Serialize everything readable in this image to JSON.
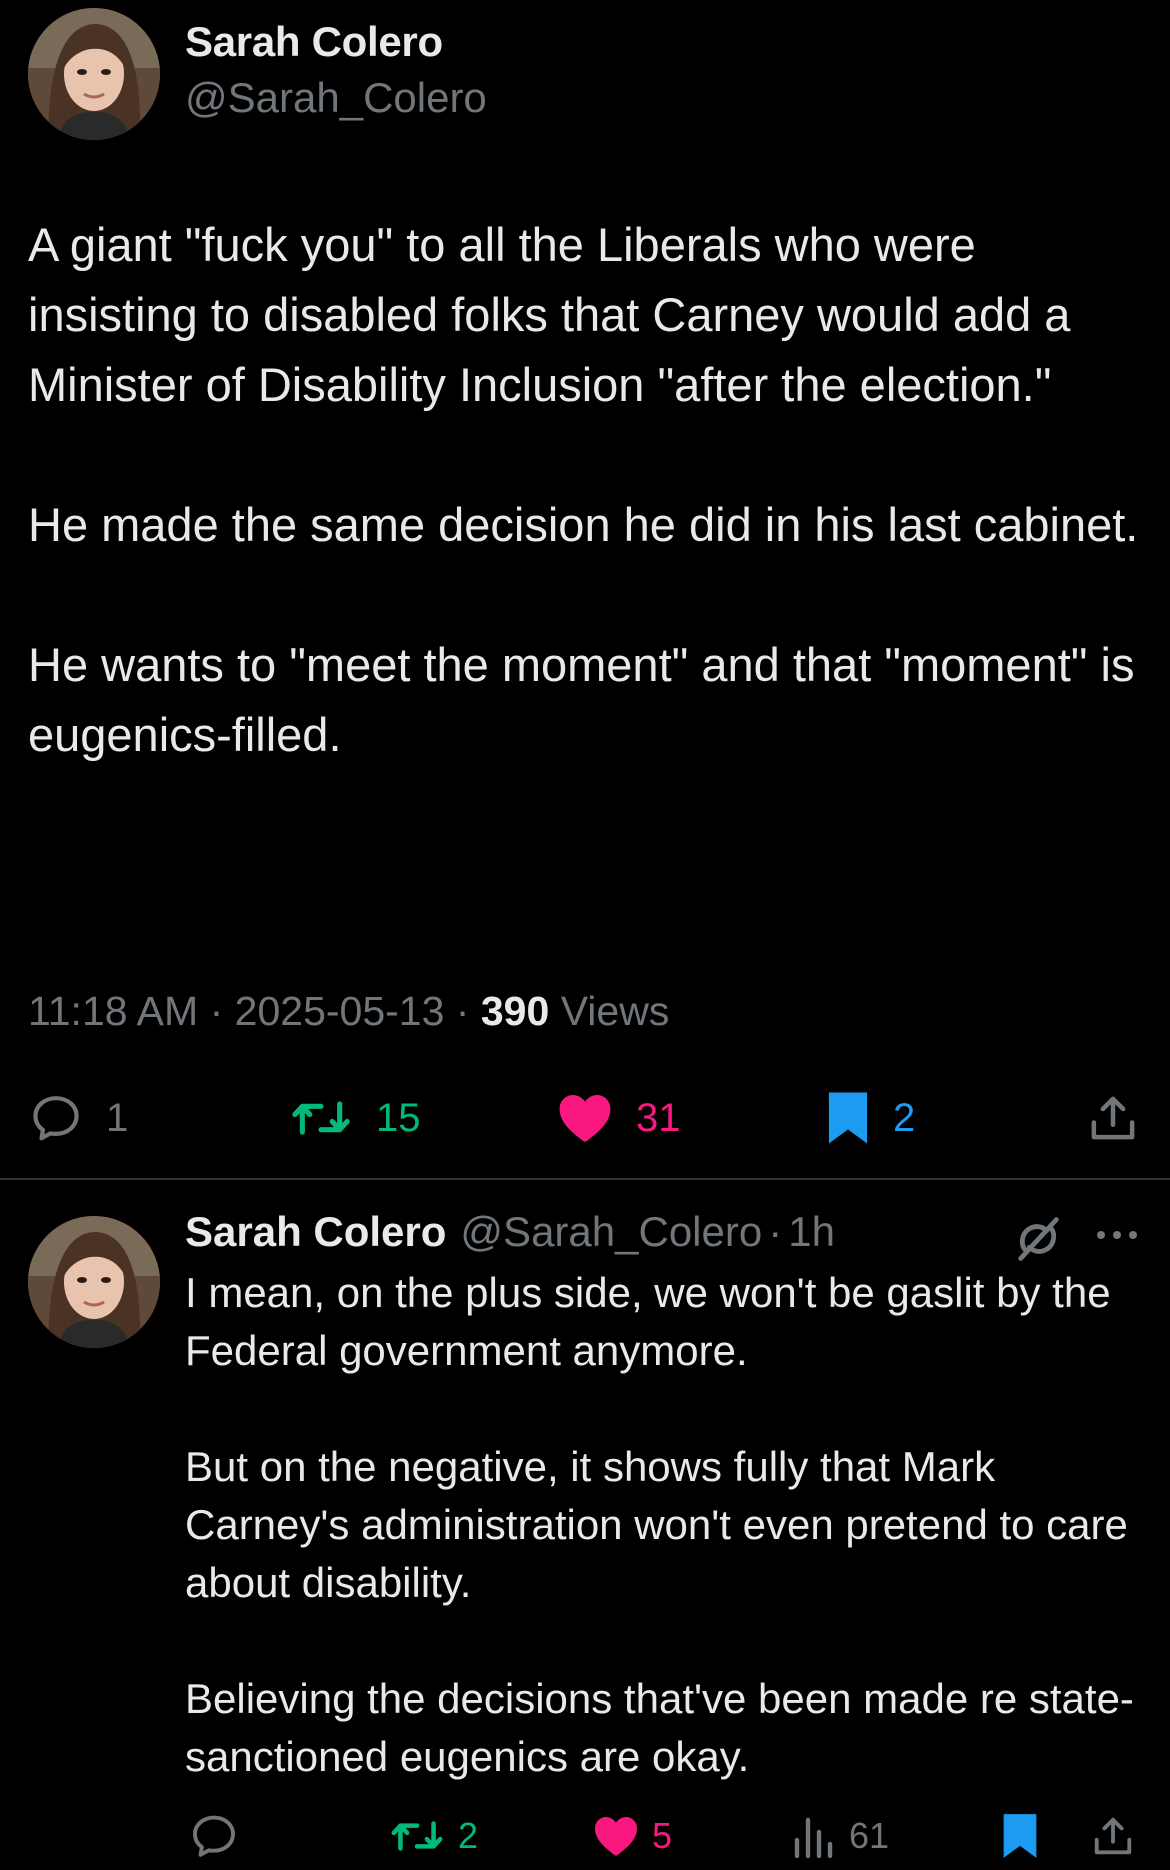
{
  "colors": {
    "background": "#000000",
    "text_primary": "#e7e9ea",
    "text_secondary": "#71767b",
    "retweet_green": "#00ba7c",
    "like_pink": "#f91880",
    "bookmark_blue": "#1d9bf0",
    "divider": "#2f3336"
  },
  "main_tweet": {
    "author_name": "Sarah Colero",
    "author_handle": "@Sarah_Colero",
    "paragraphs": [
      "A giant \"fuck you\" to all the Liberals who were insisting to disabled folks that Carney would add a Minister of Disability Inclusion \"after the election.\"",
      "He made the same decision he did in his last cabinet.",
      "He wants to \"meet the moment\" and that \"moment\" is eugenics-filled."
    ],
    "time": "11:18 AM",
    "date": "2025-05-13",
    "separator": "·",
    "views_count": "390",
    "views_label": "Views",
    "actions": {
      "replies": "1",
      "reposts": "15",
      "likes": "31",
      "bookmarks": "2"
    },
    "icons": {
      "reply": "reply-icon",
      "repost": "repost-icon",
      "like": "heart-icon-filled",
      "bookmark": "bookmark-icon-filled",
      "share": "share-icon"
    }
  },
  "reply_tweet": {
    "author_name": "Sarah Colero",
    "author_handle": "@Sarah_Colero",
    "separator": "·",
    "time_ago": "1h",
    "paragraphs": [
      "I mean, on the plus side, we won't be gaslit by the Federal government anymore.",
      "But on the negative, it shows fully that Mark Carney's administration won't even pretend to care about disability.",
      "Believing the decisions that've been made re state-sanctioned eugenics are okay."
    ],
    "actions": {
      "reposts": "2",
      "likes": "5",
      "views": "61"
    },
    "icons": {
      "grok": "grok-icon",
      "more": "more-icon",
      "reply": "reply-icon",
      "repost": "repost-icon",
      "like": "heart-icon-filled",
      "views": "analytics-icon",
      "bookmark": "bookmark-icon-filled",
      "share": "share-icon"
    }
  }
}
